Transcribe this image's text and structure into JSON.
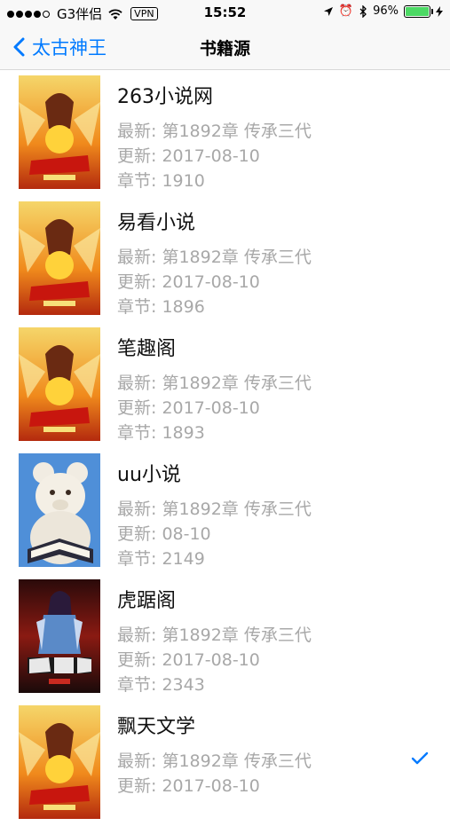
{
  "status": {
    "carrier": "G3伴侣",
    "vpn": "VPN",
    "time": "15:52",
    "battery": "96%"
  },
  "nav": {
    "back_label": "太古神王",
    "title": "书籍源"
  },
  "sources": [
    {
      "name": "263小说网",
      "latest": "最新: 第1892章 传承三代",
      "updated": "更新: 2017-08-10",
      "chapters": "章节: 1910",
      "cover": "cover-taigu"
    },
    {
      "name": "易看小说",
      "latest": "最新: 第1892章 传承三代",
      "updated": "更新: 2017-08-10",
      "chapters": "章节: 1896",
      "cover": "cover-taigu"
    },
    {
      "name": "笔趣阁",
      "latest": "最新: 第1892章 传承三代",
      "updated": "更新: 2017-08-10",
      "chapters": "章节: 1893",
      "cover": "cover-taigu"
    },
    {
      "name": "uu小说",
      "latest": "最新: 第1892章 传承三代",
      "updated": "更新: 08-10",
      "chapters": "章节: 2149",
      "cover": "cover-bear"
    },
    {
      "name": "虎踞阁",
      "latest": "最新: 第1892章 传承三代",
      "updated": "更新: 2017-08-10",
      "chapters": "章节: 2343",
      "cover": "cover-warrior"
    },
    {
      "name": "飘天文学",
      "latest": "最新: 第1892章 传承三代",
      "updated": "更新: 2017-08-10",
      "chapters": "",
      "cover": "cover-taigu",
      "selected": true
    }
  ],
  "colors": {
    "accent": "#007aff",
    "meta_text": "#a8a8a8",
    "battery": "#4cd964"
  }
}
